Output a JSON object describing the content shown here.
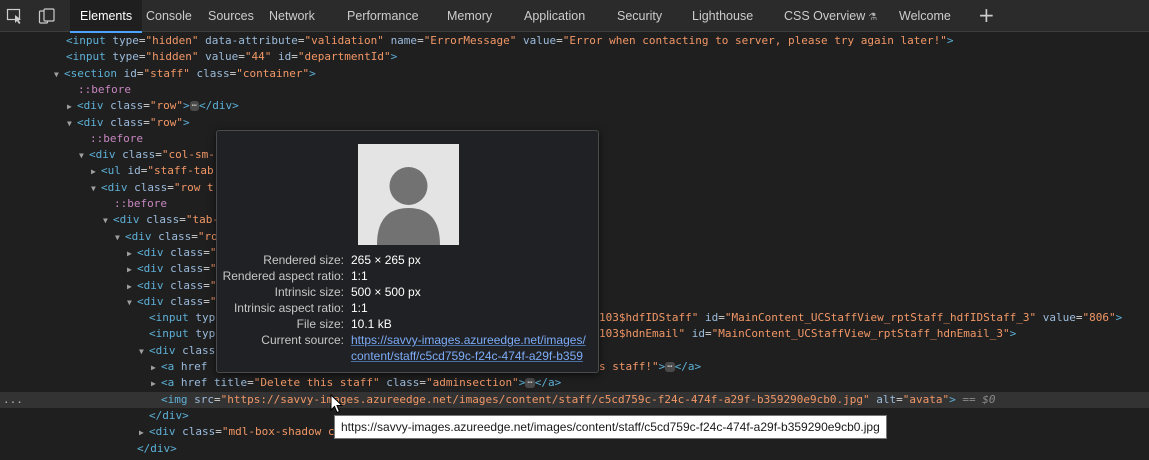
{
  "toolbar": {
    "inspect_icon": "inspect-element-icon",
    "device_icon": "device-toolbar-icon",
    "tabs": [
      {
        "label": "Elements",
        "active": true
      },
      {
        "label": "Console"
      },
      {
        "label": "Sources"
      },
      {
        "label": "Network"
      },
      {
        "label": "Performance"
      },
      {
        "label": "Memory"
      },
      {
        "label": "Application"
      },
      {
        "label": "Security"
      },
      {
        "label": "Lighthouse"
      },
      {
        "label": "CSS Overview"
      },
      {
        "label": "Welcome"
      }
    ],
    "experimental_icon": "flask-icon",
    "add_tab_icon": "+"
  },
  "dom": {
    "l1": {
      "tag": "<input",
      "a1": "type",
      "v1": "\"hidden\"",
      "a2": "data-attribute",
      "v2": "\"validation\"",
      "a3": "name",
      "v3": "\"ErrorMessage\"",
      "a4": "value",
      "v4": "\"Error when contacting to server, please try again later!\"",
      "close": ">"
    },
    "l2": {
      "tag": "<input",
      "a1": "type",
      "v1": "\"hidden\"",
      "a2": "value",
      "v2": "\"44\"",
      "a3": "id",
      "v3": "\"departmentId\"",
      "close": ">"
    },
    "l3": {
      "tag": "<section",
      "a1": "id",
      "v1": "\"staff\"",
      "a2": "class",
      "v2": "\"container\"",
      "close": ">"
    },
    "l4": {
      "pseudo": "::before"
    },
    "l5": {
      "tag": "<div",
      "a1": "class",
      "v1": "\"row\"",
      "close": ">",
      "end": "</div>"
    },
    "l6": {
      "tag": "<div",
      "a1": "class",
      "v1": "\"row\"",
      "close": ">"
    },
    "l7": {
      "pseudo": "::before"
    },
    "l8": {
      "tag": "<div",
      "a1": "class",
      "v1": "\"col-sm-"
    },
    "l9": {
      "tag": "<ul",
      "a1": "id",
      "v1": "\"staff-tab"
    },
    "l10": {
      "tag": "<div",
      "a1": "class",
      "v1": "\"row t"
    },
    "l11": {
      "pseudo": "::before"
    },
    "l12": {
      "tag": "<div",
      "a1": "class",
      "v1": "\"tab-"
    },
    "l13": {
      "tag": "<div",
      "a1": "class",
      "v1": "\"ro"
    },
    "l14": {
      "tag": "<div",
      "a1": "class",
      "v1": "\""
    },
    "l15": {
      "tag": "<div",
      "a1": "class",
      "v1": "\""
    },
    "l16": {
      "tag": "<div",
      "a1": "class",
      "v1": "\""
    },
    "l17": {
      "tag": "<div",
      "a1": "class",
      "v1": "\""
    },
    "l18": {
      "tag": "<input",
      "a1": "typ",
      "rest_v": "103$hdfIDStaff\"",
      "a2": "id",
      "v2": "\"MainContent_UCStaffView_rptStaff_hdfIDStaff_3\"",
      "a3": "value",
      "v3": "\"806\"",
      "close": ">"
    },
    "l19": {
      "tag": "<input",
      "a1": "typ",
      "rest_v": "103$hdnEmail\"",
      "a2": "id",
      "v2": "\"MainContent_UCStaffView_rptStaff_hdnEmail_3\"",
      "close": ">"
    },
    "l20": {
      "tag": "<div",
      "a1": "class"
    },
    "l21": {
      "tag": "<a",
      "a1": "href",
      "rest_v": "s staff!\"",
      "close": ">",
      "end": "</a>"
    },
    "l22": {
      "tag": "<a",
      "a1": "href",
      "a2": "title",
      "v2": "\"Delete this staff\"",
      "a3": "class",
      "v3": "\"adminsection\"",
      "close": ">",
      "end": "</a>"
    },
    "l23": {
      "tag": "<img",
      "a1": "src",
      "v1": "\"https://savvy-images.azureedge.net/images/content/staff/c5cd759c-f24c-474f-a29f-b359290e9cb0.jpg\"",
      "a2": "alt",
      "v2": "\"avata\"",
      "close": ">",
      "suffix": "== $0"
    },
    "l24": {
      "end": "</div>"
    },
    "l25": {
      "tag": "<div",
      "a1": "class",
      "v1": "\"mdl-box-shadow c"
    },
    "l26": {
      "end": "</div>"
    },
    "row_menu": "..."
  },
  "popover": {
    "avatar_icon": "avatar-placeholder-icon",
    "rows": [
      {
        "label": "Rendered size:",
        "value": "265 × 265 px"
      },
      {
        "label": "Rendered aspect ratio:",
        "value": "1:1"
      },
      {
        "label": "Intrinsic size:",
        "value": "500 × 500 px"
      },
      {
        "label": "Intrinsic aspect ratio:",
        "value": "1:1"
      },
      {
        "label": "File size:",
        "value": "10.1 kB"
      },
      {
        "label": "Current source:",
        "value": "https://savvy-images.azureedge.net/images/",
        "value2": "content/staff/c5cd759c-f24c-474f-a29f-b359"
      }
    ]
  },
  "tooltip": {
    "text": "https://savvy-images.azureedge.net/images/content/staff/c5cd759c-f24c-474f-a29f-b359290e9cb0.jpg"
  },
  "cursor_icon": "mouse-pointer-icon",
  "colors": {
    "tag": "#5db0d7",
    "attr_name": "#9bbbdc",
    "attr_value": "#f29766",
    "link": "#7cacf8",
    "active_tab_underline": "#4da3ff"
  }
}
